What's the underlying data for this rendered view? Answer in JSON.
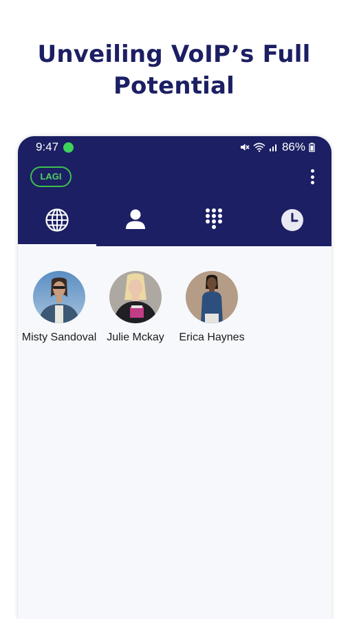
{
  "headline": {
    "line1": "Unveiling VoIP’s Full",
    "line2": "Potential"
  },
  "status_bar": {
    "time": "9:47",
    "battery": "86%",
    "icons": [
      "mute-icon",
      "wifi-icon",
      "signal-icon",
      "battery-icon"
    ]
  },
  "toolbar": {
    "badge_label": "LAGI",
    "menu_icon": "more-vert-icon"
  },
  "tabs": [
    {
      "name": "globe",
      "icon": "globe-icon",
      "active": true
    },
    {
      "name": "contacts",
      "icon": "person-icon",
      "active": false
    },
    {
      "name": "dialpad",
      "icon": "dialpad-icon",
      "active": false
    },
    {
      "name": "recents",
      "icon": "clock-icon",
      "active": false
    }
  ],
  "contacts": [
    {
      "name": "Misty Sandoval"
    },
    {
      "name": "Julie Mckay"
    },
    {
      "name": "Erica Haynes"
    }
  ],
  "colors": {
    "brand_navy": "#1c1f63",
    "badge_green": "#3cc14e",
    "status_dot": "#3ed35a",
    "content_bg": "#f7f8fb"
  }
}
